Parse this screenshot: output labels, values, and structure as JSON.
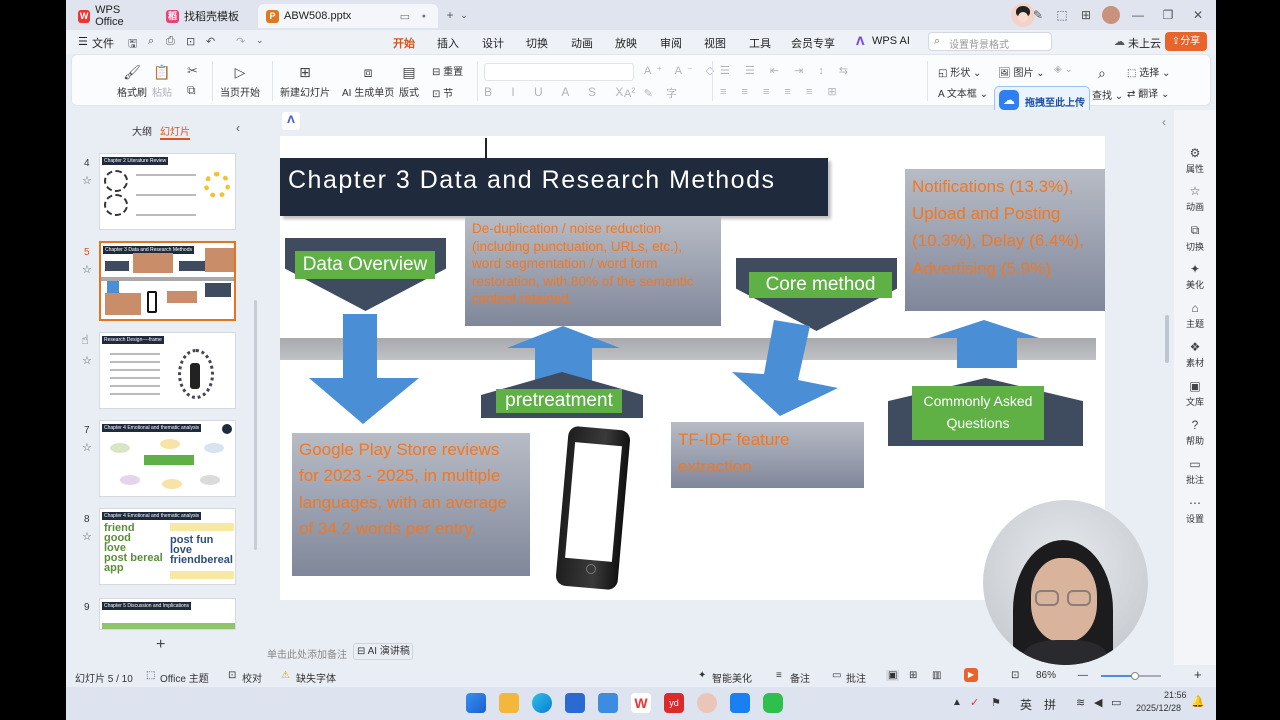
{
  "titlebar": {
    "tabs": [
      {
        "label": "WPS Office",
        "icon": "wps-logo-icon"
      },
      {
        "label": "找稻壳模板",
        "icon": "docer-icon"
      },
      {
        "label": "ABW508.pptx",
        "icon": "ppt-file-icon"
      }
    ],
    "new_tab": "+"
  },
  "menubar": {
    "file": "文件",
    "items": [
      "开始",
      "插入",
      "设计",
      "切换",
      "动画",
      "放映",
      "审阅",
      "视图",
      "工具",
      "会员专享",
      "WPS AI"
    ],
    "active": "开始",
    "search_placeholder": "设置背景格式",
    "cloud": "未上云",
    "share": "分享"
  },
  "ribbon": {
    "format_painter": "格式刷",
    "paste": "粘贴",
    "current_start": "当页开始",
    "new_slide": "新建幻灯片",
    "ai_slide": "AI 生成单页",
    "layout": "版式",
    "reset": "重置",
    "section": "节",
    "shape": "形状",
    "picture": "图片",
    "textbox": "文本框",
    "find": "查找",
    "select": "选择",
    "translate": "翻译",
    "upload_tip": "拖拽至此上传"
  },
  "leftpanel": {
    "tab_outline": "大纲",
    "tab_slides": "幻灯片",
    "slides": [
      {
        "no": "4",
        "title": "Chapter 2 Literature Review"
      },
      {
        "no": "5",
        "title": "Chapter 3 Data and Research Methods"
      },
      {
        "no": "",
        "title": "Research Design----frame"
      },
      {
        "no": "7",
        "title": "Chapter 4 Emotional and thematic analysis"
      },
      {
        "no": "8",
        "title": "Chapter 4 Emotional and thematic analysis"
      },
      {
        "no": "9",
        "title": "Chapter 5 Discussion and Implications"
      }
    ],
    "add": "+"
  },
  "slide": {
    "title": "Chapter 3 Data and Research Methods",
    "data_overview": "Data Overview",
    "pretreatment": "pretreatment",
    "core_method": "Core method",
    "faq": "Commonly Asked Questions",
    "dedup": "De-duplication / noise reduction (including punctuation, URLs, etc.), word segmentation / word form restoration, with 80% of the semantic content retained.",
    "google": "Google Play Store reviews for 2023 - 2025, in multiple languages, with an average of 34.2 words per entry.",
    "tfidf": "TF-IDF feature extraction",
    "notifications": "Notifications (13.3%), Upload and Posting (10.3%), Delay (6.4%), Advertising (5.9%)"
  },
  "notes_placeholder": "单击此处添加备注",
  "ai_speech": "AI 演讲稿",
  "rightbar": [
    "属性",
    "动画",
    "切换",
    "美化",
    "主题",
    "素材",
    "文库",
    "帮助",
    "批注",
    "设置"
  ],
  "statusbar": {
    "slide_count": "幻灯片 5 / 10",
    "theme": "Office 主题",
    "proof": "校对",
    "missing_font": "缺失字体",
    "smart": "智能美化",
    "notes": "备注",
    "comment": "批注",
    "zoom": "86%"
  },
  "taskbar": {
    "ime1": "英",
    "ime2": "拼",
    "time": "21:56",
    "date": "2025/12/28"
  },
  "colors": {
    "accent": "#d9541e",
    "slide_title_bg": "#1f2a3c",
    "green_label": "#5fb146",
    "orange_text": "#f4761f",
    "arrow_blue": "#4a8fd6"
  }
}
